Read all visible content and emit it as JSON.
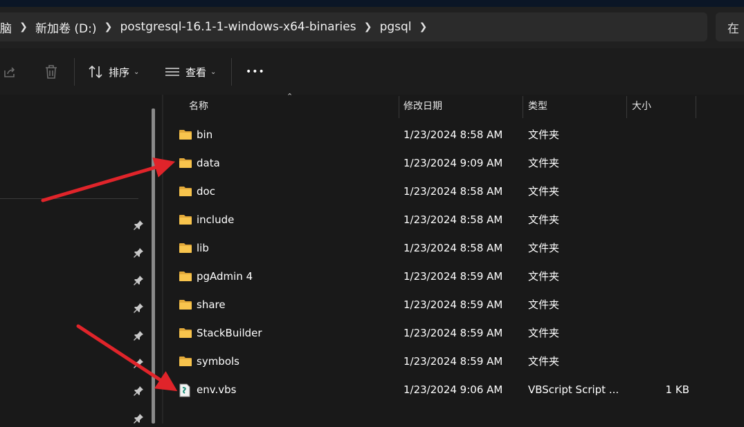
{
  "address": {
    "crumbs": [
      "脑",
      "新加卷 (D:)",
      "postgresql-16.1-1-windows-x64-binaries",
      "pgsql"
    ],
    "search_label": "在"
  },
  "toolbar": {
    "sort_label": "排序",
    "view_label": "查看",
    "more_label": "•••"
  },
  "columns": {
    "name": "名称",
    "date": "修改日期",
    "type": "类型",
    "size": "大小"
  },
  "files": [
    {
      "name": "bin",
      "date": "1/23/2024 8:58 AM",
      "type": "文件夹",
      "size": "",
      "icon": "folder-icon"
    },
    {
      "name": "data",
      "date": "1/23/2024 9:09 AM",
      "type": "文件夹",
      "size": "",
      "icon": "folder-icon"
    },
    {
      "name": "doc",
      "date": "1/23/2024 8:58 AM",
      "type": "文件夹",
      "size": "",
      "icon": "folder-icon"
    },
    {
      "name": "include",
      "date": "1/23/2024 8:58 AM",
      "type": "文件夹",
      "size": "",
      "icon": "folder-icon"
    },
    {
      "name": "lib",
      "date": "1/23/2024 8:58 AM",
      "type": "文件夹",
      "size": "",
      "icon": "folder-icon"
    },
    {
      "name": "pgAdmin 4",
      "date": "1/23/2024 8:59 AM",
      "type": "文件夹",
      "size": "",
      "icon": "folder-icon"
    },
    {
      "name": "share",
      "date": "1/23/2024 8:59 AM",
      "type": "文件夹",
      "size": "",
      "icon": "folder-icon"
    },
    {
      "name": "StackBuilder",
      "date": "1/23/2024 8:59 AM",
      "type": "文件夹",
      "size": "",
      "icon": "folder-icon"
    },
    {
      "name": "symbols",
      "date": "1/23/2024 8:59 AM",
      "type": "文件夹",
      "size": "",
      "icon": "folder-icon"
    },
    {
      "name": "env.vbs",
      "date": "1/23/2024 9:06 AM",
      "type": "VBScript Script ...",
      "size": "1 KB",
      "icon": "vbscript-file-icon"
    }
  ],
  "colors": {
    "folder": "#f8c44d",
    "annotation_arrow": "#e0242a"
  }
}
